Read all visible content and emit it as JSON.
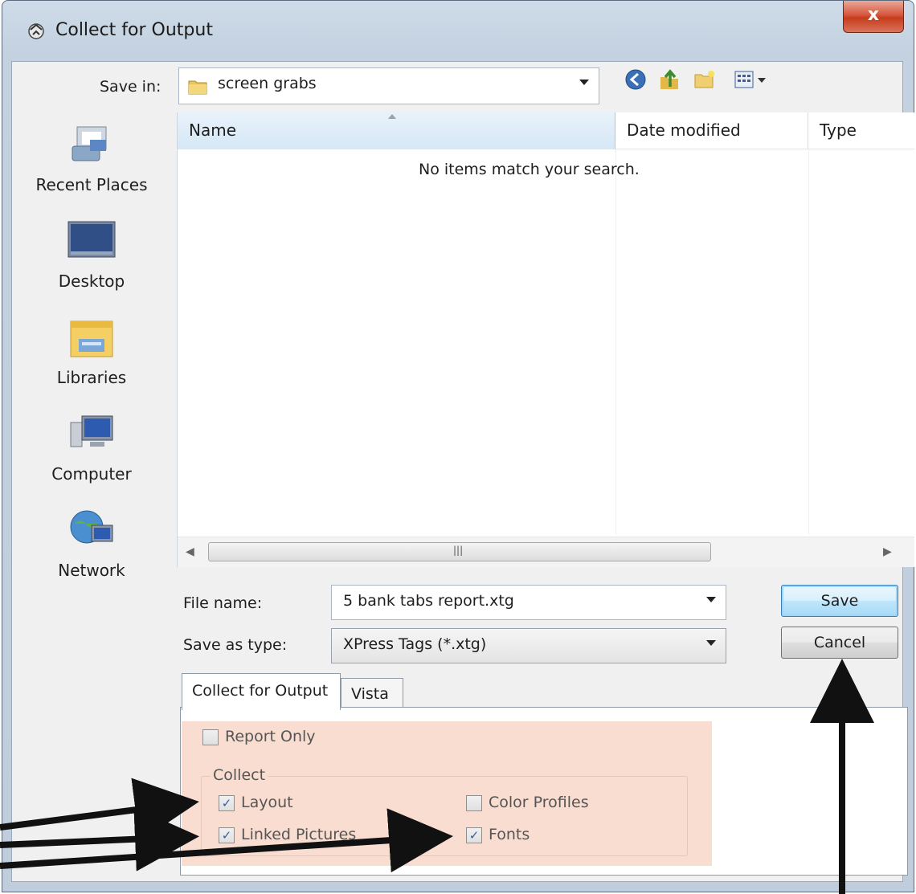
{
  "window": {
    "title": "Collect for Output",
    "close_label": "x"
  },
  "save_in": {
    "label": "Save in:",
    "mnemonic": "i",
    "value": "screen grabs"
  },
  "toolbar": {
    "icons": [
      "back-icon",
      "up-folder-icon",
      "new-folder-icon",
      "views-menu-icon"
    ]
  },
  "places": [
    {
      "label": "Recent Places",
      "icon": "recent-places-icon"
    },
    {
      "label": "Desktop",
      "icon": "desktop-icon"
    },
    {
      "label": "Libraries",
      "icon": "libraries-icon"
    },
    {
      "label": "Computer",
      "icon": "computer-icon"
    },
    {
      "label": "Network",
      "icon": "network-icon"
    }
  ],
  "file_list": {
    "columns": [
      "Name",
      "Date modified",
      "Type"
    ],
    "empty_message": "No items match your search."
  },
  "file_name": {
    "label": "File name:",
    "value": "5 bank tabs report.xtg"
  },
  "save_as_type": {
    "label": "Save as type:",
    "value": "XPress Tags (*.xtg)"
  },
  "buttons": {
    "save": "Save",
    "cancel": "Cancel"
  },
  "tabs": [
    "Collect for Output",
    "Vista"
  ],
  "options": {
    "report_only": {
      "label": "Report Only",
      "checked": false
    },
    "collect_group": "Collect",
    "layout": {
      "label": "Layout",
      "checked": true
    },
    "linked_pictures": {
      "label": "Linked Pictures",
      "checked": true
    },
    "color_profiles": {
      "label": "Color Profiles",
      "checked": false
    },
    "fonts": {
      "label": "Fonts",
      "checked": true
    }
  },
  "colors": {
    "highlight": "#f9ddd0",
    "close_button": "#c63c1d",
    "default_button": "#bee6fd"
  }
}
